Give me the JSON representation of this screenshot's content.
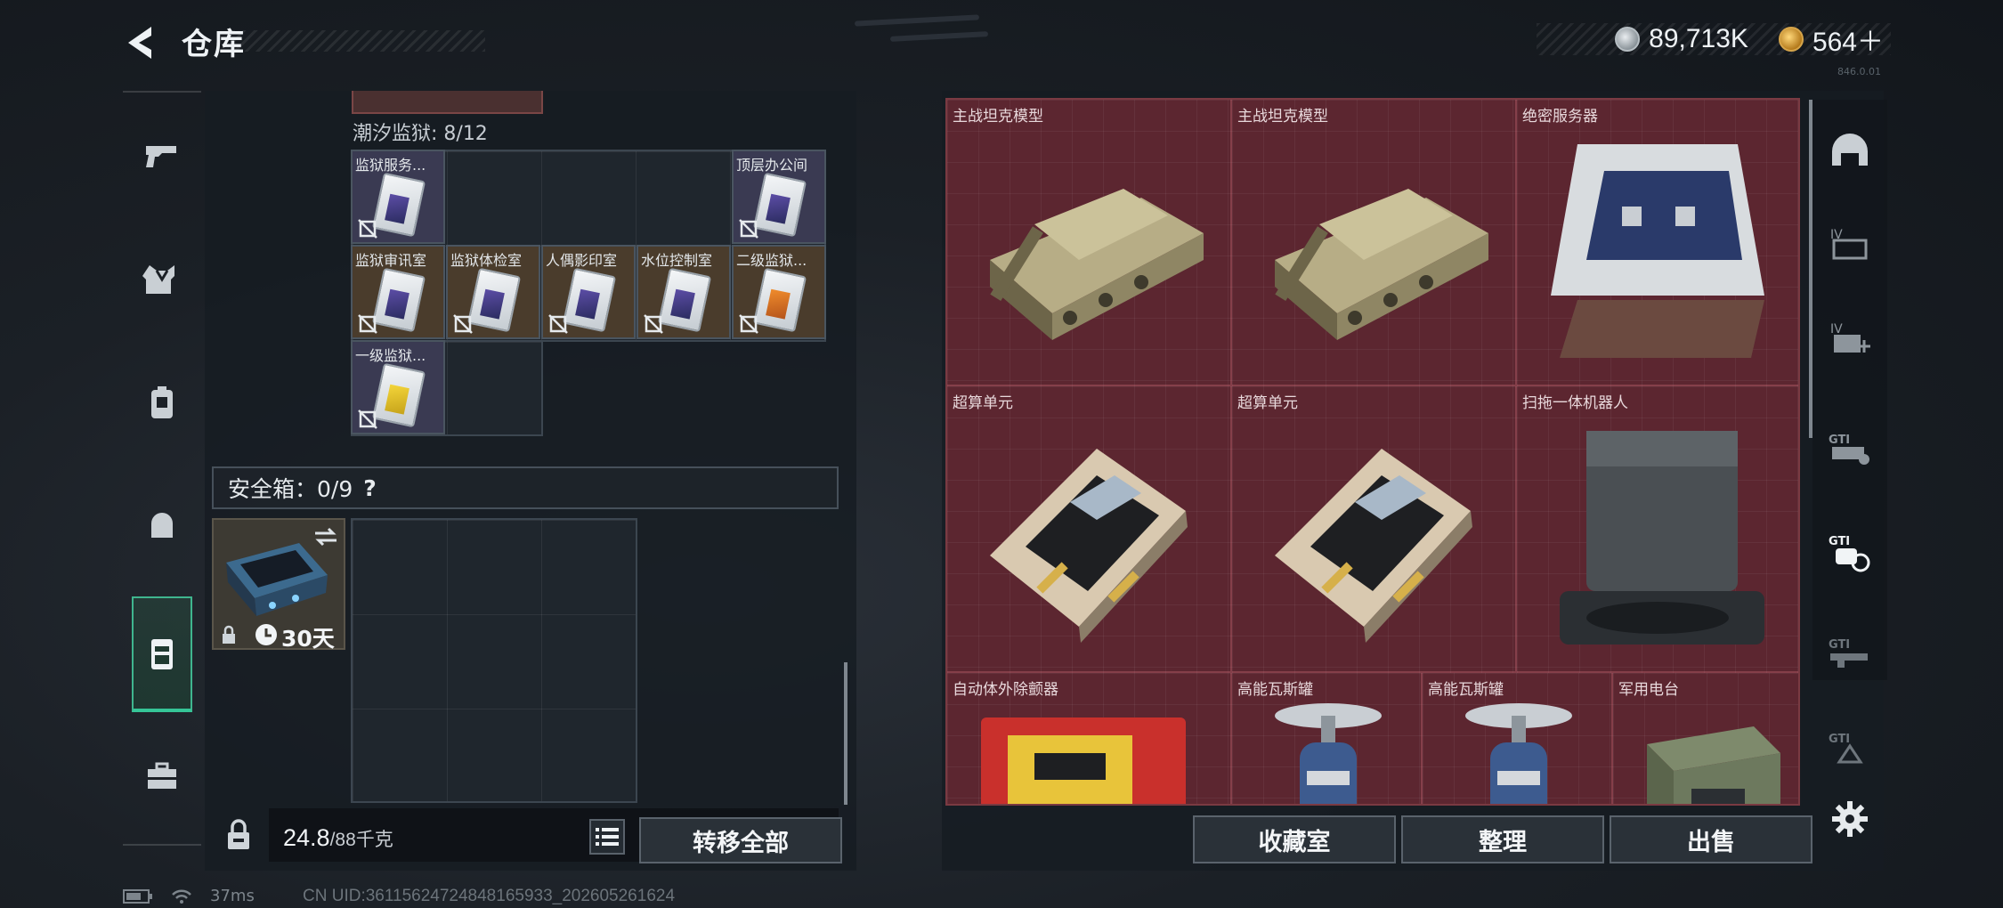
{
  "header": {
    "title": "仓库",
    "back_icon": "back-arrow-icon"
  },
  "currency": {
    "silver_value": "89,713K",
    "gold_value": "564＋"
  },
  "version_text": "846.0.01",
  "left_rail": {
    "tabs": [
      {
        "icon": "pistol-icon"
      },
      {
        "icon": "armor-vest-icon"
      },
      {
        "icon": "backpack-icon"
      },
      {
        "icon": "helmet-bag-icon"
      },
      {
        "icon": "keycard-case-icon",
        "active": true
      },
      {
        "icon": "briefcase-icon"
      }
    ]
  },
  "storage": {
    "section_title": "潮汐监狱: 8/12",
    "cards": [
      {
        "label": "监狱服务...",
        "rarity": "purple",
        "color": "purple"
      },
      {
        "label": "顶层办公间",
        "rarity": "purple",
        "color": "purple"
      },
      {
        "label": "监狱审讯室",
        "rarity": "gold",
        "color": "purple"
      },
      {
        "label": "监狱体检室",
        "rarity": "gold",
        "color": "purple"
      },
      {
        "label": "人偶影印室",
        "rarity": "gold",
        "color": "purple"
      },
      {
        "label": "水位控制室",
        "rarity": "gold",
        "color": "purple"
      },
      {
        "label": "二级监狱...",
        "rarity": "gold",
        "color": "orange"
      },
      {
        "label": "一级监狱...",
        "rarity": "purple",
        "color": "yellow"
      }
    ],
    "safe_box_label": "安全箱：0/9",
    "safe_box_help": "?",
    "safe_item_duration": "30天",
    "weight_current": "24.8",
    "weight_max": "/88千克",
    "transfer_all_label": "转移全部"
  },
  "right_items": [
    {
      "label": "主战坦克模型",
      "kind": "tank"
    },
    {
      "label": "主战坦克模型",
      "kind": "tank"
    },
    {
      "label": "绝密服务器",
      "kind": "server"
    },
    {
      "label": "超算单元",
      "kind": "board"
    },
    {
      "label": "超算单元",
      "kind": "board"
    },
    {
      "label": "扫拖一体机器人",
      "kind": "robot"
    },
    {
      "label": "自动体外除颤器",
      "kind": "aed"
    },
    {
      "label": "高能瓦斯罐",
      "kind": "gas"
    },
    {
      "label": "高能瓦斯罐",
      "kind": "gas"
    },
    {
      "label": "军用电台",
      "kind": "radio"
    }
  ],
  "right_rail": {
    "icons": [
      "helmet-icon",
      "folder-iv-icon",
      "add-iv-icon",
      "gti-settings-icon",
      "gti-active-icon",
      "gti-weapon-icon",
      "gti-triangle-icon",
      "gear-icon"
    ]
  },
  "bottom_actions": {
    "collection_label": "收藏室",
    "organize_label": "整理",
    "sell_label": "出售"
  },
  "status": {
    "ping": "37ms",
    "uid": "CN UID:361156247248481659​33_202605261624"
  },
  "colors": {
    "accent_green": "#35c597",
    "red_grid": "#5c2630",
    "purple_card": "#3a3a52",
    "gold_card": "#4a3c2c"
  }
}
